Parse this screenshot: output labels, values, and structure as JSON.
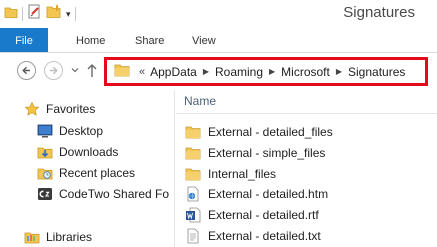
{
  "window": {
    "title": "Signatures"
  },
  "quick_access": {
    "icons": [
      "folder-icon",
      "properties-icon",
      "new-folder-icon"
    ],
    "dropdown": "▾"
  },
  "ribbon": {
    "tabs": [
      "File",
      "Home",
      "Share",
      "View"
    ]
  },
  "address_bar": {
    "overflow": "«",
    "path": [
      "AppData",
      "Roaming",
      "Microsoft",
      "Signatures"
    ],
    "highlight_color": "#e30a1b"
  },
  "nav_pane": {
    "items": [
      {
        "label": "Favorites",
        "icon": "star-icon"
      },
      {
        "label": "Desktop",
        "icon": "desktop-icon"
      },
      {
        "label": "Downloads",
        "icon": "downloads-icon"
      },
      {
        "label": "Recent places",
        "icon": "recent-places-icon"
      },
      {
        "label": "CodeTwo Shared Fo",
        "icon": "codetwo-icon"
      },
      {
        "label": "Libraries",
        "icon": "libraries-icon"
      }
    ]
  },
  "file_list": {
    "column": "Name",
    "files": [
      {
        "name": "External - detailed_files",
        "icon": "folder-icon"
      },
      {
        "name": "External - simple_files",
        "icon": "folder-icon"
      },
      {
        "name": "Internal_files",
        "icon": "folder-icon"
      },
      {
        "name": "External - detailed.htm",
        "icon": "html-file-icon"
      },
      {
        "name": "External - detailed.rtf",
        "icon": "word-file-icon"
      },
      {
        "name": "External - detailed.txt",
        "icon": "text-file-icon"
      }
    ]
  },
  "colors": {
    "file_tab": "#1979ca",
    "folder": "#f3c552",
    "column_header": "#4c607a"
  }
}
